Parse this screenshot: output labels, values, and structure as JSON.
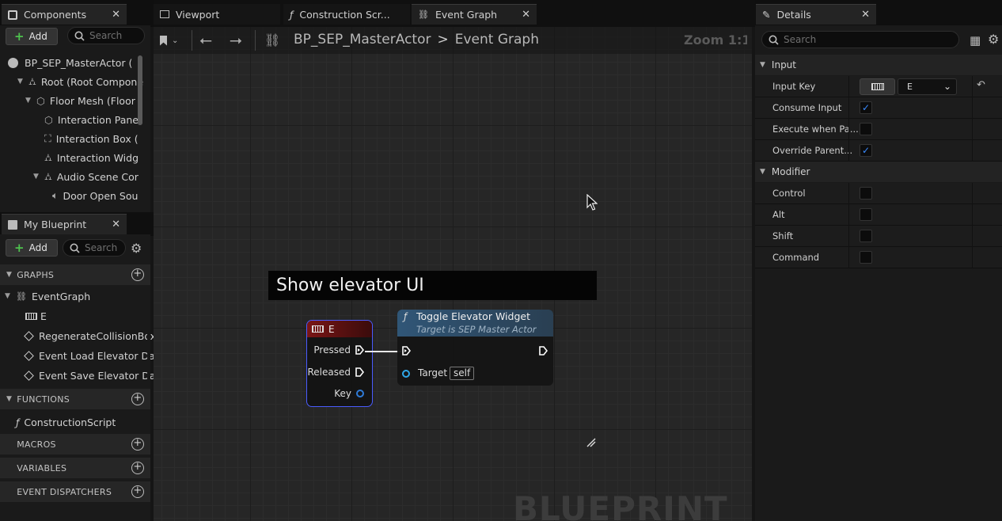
{
  "components_panel": {
    "tab_label": "Components",
    "add_label": "Add",
    "search_placeholder": "Search",
    "tree": [
      {
        "label": "BP_SEP_MasterActor (",
        "icon": "actor-icon"
      },
      {
        "label": "Root (Root Compone",
        "icon": "scene-icon"
      },
      {
        "label": "Floor Mesh (Floor",
        "icon": "static-mesh-icon"
      },
      {
        "label": "Interaction Pane",
        "icon": "static-mesh-icon"
      },
      {
        "label": "Interaction Box (",
        "icon": "box-collision-icon"
      },
      {
        "label": "Interaction Widg",
        "icon": "widget-component-icon"
      },
      {
        "label": "Audio Scene Cor",
        "icon": "scene-icon"
      },
      {
        "label": "Door Open Sou",
        "icon": "audio-icon"
      }
    ]
  },
  "my_blueprint": {
    "tab_label": "My Blueprint",
    "add_label": "Add",
    "search_placeholder": "Search",
    "graphs_header": "GRAPHS",
    "graph_items": [
      {
        "label": "EventGraph",
        "icon": "event-graph-icon"
      },
      {
        "label": "E",
        "icon": "keyboard-icon"
      },
      {
        "label": "RegenerateCollisionBox",
        "icon": "event-diamond-icon"
      },
      {
        "label": "Event Load Elevator Dat",
        "icon": "event-diamond-icon"
      },
      {
        "label": "Event Save Elevator Dat",
        "icon": "event-diamond-icon"
      }
    ],
    "functions_header": "FUNCTIONS",
    "function_items": [
      {
        "label": "ConstructionScript",
        "icon": "function-icon"
      }
    ],
    "macros_header": "MACROS",
    "variables_header": "VARIABLES",
    "dispatchers_header": "EVENT DISPATCHERS"
  },
  "editor_tabs": [
    {
      "label": "Viewport",
      "icon": "viewport-icon"
    },
    {
      "label": "Construction Scr...",
      "icon": "function-icon"
    },
    {
      "label": "Event Graph",
      "icon": "event-graph-icon"
    }
  ],
  "graph_toolbar": {
    "breadcrumb_root": "BP_SEP_MasterActor",
    "breadcrumb_separator": ">",
    "breadcrumb_current": "Event Graph",
    "zoom_label": "Zoom 1:1"
  },
  "graph": {
    "comment_text": "Show elevator UI",
    "event_node": {
      "title": "E",
      "pins": [
        "Pressed",
        "Released",
        "Key"
      ]
    },
    "function_node": {
      "title": "Toggle Elevator Widget",
      "subtitle": "Target is SEP Master Actor",
      "target_label": "Target",
      "target_default": "self"
    },
    "watermark": "BLUEPRINT"
  },
  "details_panel": {
    "tab_label": "Details",
    "search_placeholder": "Search",
    "input_category": "Input",
    "input_rows": [
      {
        "label": "Input Key",
        "value": "E"
      },
      {
        "label": "Consume Input",
        "checked": true
      },
      {
        "label": "Execute when Pa...",
        "checked": false
      },
      {
        "label": "Override Parent...",
        "checked": true
      }
    ],
    "modifier_category": "Modifier",
    "modifier_rows": [
      {
        "label": "Control",
        "checked": false
      },
      {
        "label": "Alt",
        "checked": false
      },
      {
        "label": "Shift",
        "checked": false
      },
      {
        "label": "Command",
        "checked": false
      }
    ]
  },
  "colors": {
    "accent_blue": "#3a8bff",
    "event_header": "#6b1212",
    "function_header": "#2a4a66",
    "add_green": "#4ec24e"
  }
}
